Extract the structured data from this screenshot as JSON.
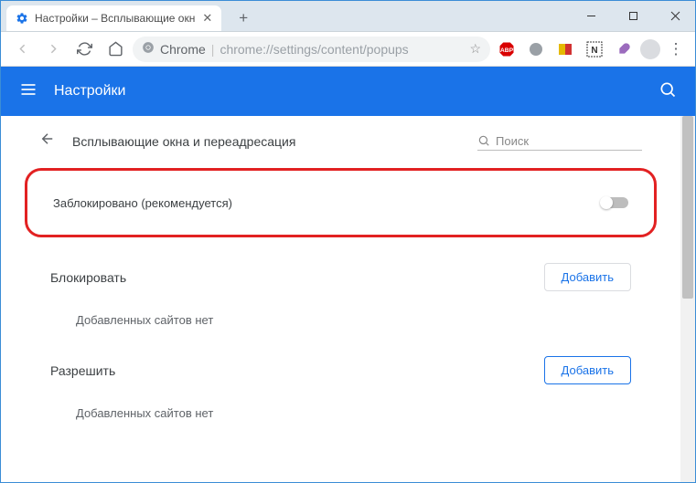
{
  "window": {
    "tab_title": "Настройки – Всплывающие окн",
    "url_label": "Chrome",
    "url_path": "chrome://settings/content/popups"
  },
  "header": {
    "title": "Настройки"
  },
  "section": {
    "title": "Всплывающие окна и переадресация",
    "search_placeholder": "Поиск"
  },
  "toggle_row": {
    "label": "Заблокировано (рекомендуется)",
    "enabled": false
  },
  "block_section": {
    "title": "Блокировать",
    "add_label": "Добавить",
    "empty": "Добавленных сайтов нет"
  },
  "allow_section": {
    "title": "Разрешить",
    "add_label": "Добавить",
    "empty": "Добавленных сайтов нет"
  }
}
